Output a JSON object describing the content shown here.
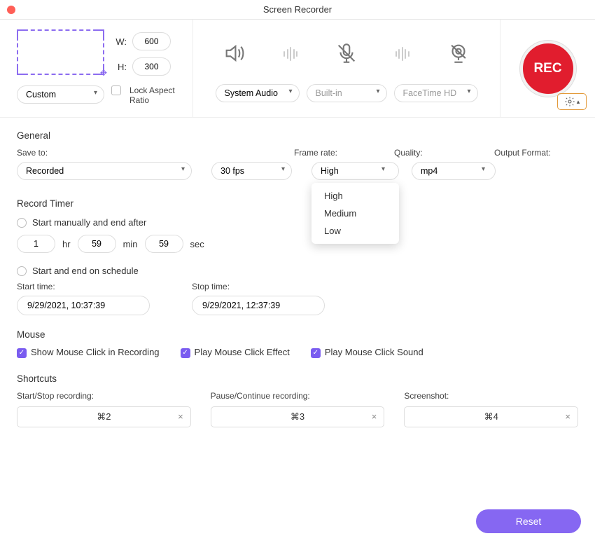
{
  "window": {
    "title": "Screen Recorder"
  },
  "region": {
    "w_label": "W:",
    "h_label": "H:",
    "width": "600",
    "height": "300",
    "mode": "Custom",
    "lock_label": "Lock Aspect Ratio",
    "lock_checked": false
  },
  "audio": {
    "system_sel": "System Audio",
    "mic_sel": "Built-in",
    "cam_sel": "FaceTime HD"
  },
  "rec": {
    "label": "REC"
  },
  "general": {
    "heading": "General",
    "save_to_label": "Save to:",
    "save_to": "Recorded",
    "frame_label": "Frame rate:",
    "frame": "30 fps",
    "quality_label": "Quality:",
    "quality": "High",
    "quality_opts": {
      "a": "High",
      "b": "Medium",
      "c": "Low"
    },
    "format_label": "Output Format:",
    "format": "mp4"
  },
  "timer": {
    "heading": "Record Timer",
    "manual_label": "Start manually and end after",
    "hr_val": "1",
    "hr_unit": "hr",
    "min_val": "59",
    "min_unit": "min",
    "sec_val": "59",
    "sec_unit": "sec",
    "sched_label": "Start and end on schedule",
    "start_label": "Start time:",
    "start_val": "9/29/2021, 10:37:39",
    "stop_label": "Stop time:",
    "stop_val": "9/29/2021, 12:37:39"
  },
  "mouse": {
    "heading": "Mouse",
    "show_click": "Show Mouse Click in Recording",
    "play_effect": "Play Mouse Click Effect",
    "play_sound": "Play Mouse Click Sound"
  },
  "shortcuts": {
    "heading": "Shortcuts",
    "start_label": "Start/Stop recording:",
    "start_key": "⌘2",
    "pause_label": "Pause/Continue recording:",
    "pause_key": "⌘3",
    "shot_label": "Screenshot:",
    "shot_key": "⌘4"
  },
  "footer": {
    "reset": "Reset"
  }
}
